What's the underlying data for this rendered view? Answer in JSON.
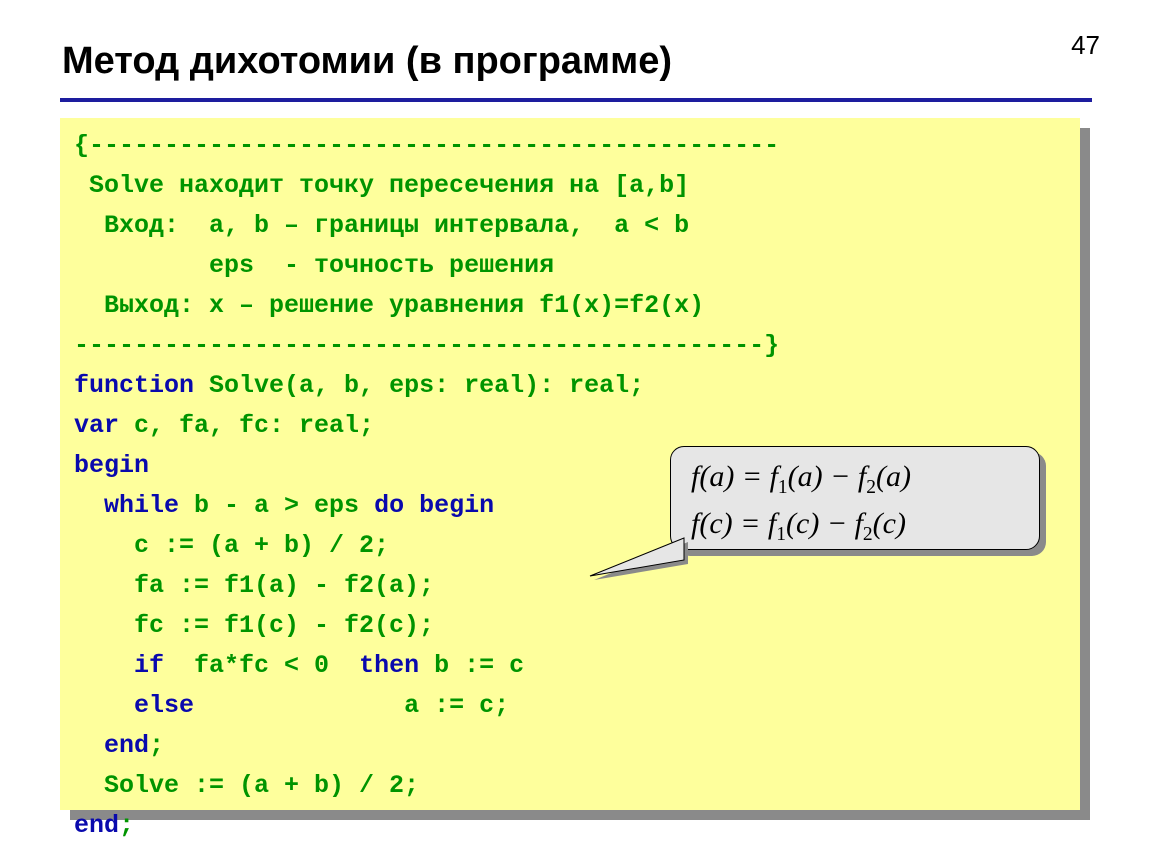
{
  "page_number": "47",
  "title": "Метод дихотомии (в программе)",
  "code": {
    "l1": "{----------------------------------------------",
    "l2": " Solve находит точку пересечения на [a,b]",
    "l3": "  Вход:  a, b – границы интервала,  a < b",
    "l4": "         eps  - точность решения",
    "l5": "  Выход: x – решение уравнения f1(x)=f2(x)",
    "l6": "----------------------------------------------}",
    "l7a": "function",
    "l7b": " Solve(a, b, eps: real): real;",
    "l8a": "var",
    "l8b": " c, fa, fc: real;",
    "l9": "begin",
    "l10a": "  ",
    "l10b": "while",
    "l10c": " b - a > eps ",
    "l10d": "do begin",
    "l11": "    c := (a + b) / 2;",
    "l12": "    fa := f1(a) - f2(a);",
    "l13": "    fc := f1(c) - f2(c);",
    "l14a": "    ",
    "l14b": "if",
    "l14c": "  fa*fc < 0  ",
    "l14d": "then",
    "l14e": " b := c",
    "l15a": "    ",
    "l15b": "else",
    "l15c": "              a := c;",
    "l16a": "  ",
    "l16b": "end",
    "l16c": ";",
    "l17": "  Solve := (a + b) / 2;",
    "l18a": "end",
    "l18b": ";"
  },
  "formula": {
    "line1_parts": [
      "f",
      "(",
      "a",
      ") = ",
      "f",
      "1",
      "(",
      "a",
      ") − ",
      "f",
      "2",
      "(",
      "a",
      ")"
    ],
    "line2_parts": [
      "f",
      "(",
      "c",
      ") = ",
      "f",
      "1",
      "(",
      "c",
      ") − ",
      "f",
      "2",
      "(",
      "c",
      ")"
    ]
  }
}
